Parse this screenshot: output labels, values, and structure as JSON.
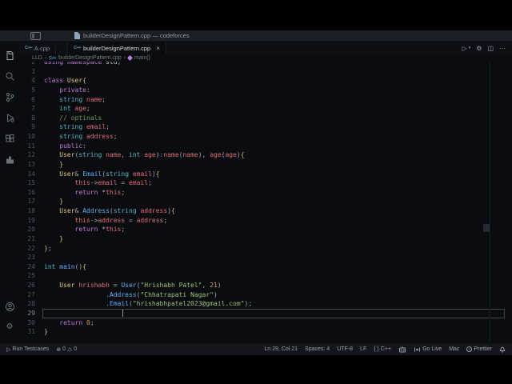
{
  "titlebar": {
    "title": "builderDesignPattern.cpp — codeforces"
  },
  "tabs": {
    "tab1": {
      "label": "A.cpp"
    },
    "tab2": {
      "label": "builderDesignPattern.cpp"
    }
  },
  "icons": {
    "run": "▷",
    "caret": "▾",
    "gear": "⚙",
    "split": "◫",
    "more": "⋯",
    "error": "⊗",
    "warning": "⚠",
    "play": "▷",
    "cpp": "C++",
    "chevron": "›",
    "close": "×",
    "check": "✓"
  },
  "breadcrumb": {
    "folder": "LLD",
    "file": "builderDesignPattern.cpp",
    "symbol": "main()"
  },
  "code": {
    "lines": [
      {
        "n": 2,
        "t": [
          [
            "k",
            "using"
          ],
          [
            "w",
            " "
          ],
          [
            "k",
            "namespace"
          ],
          [
            "w",
            " std"
          ],
          [
            "p",
            ";"
          ]
        ]
      },
      {
        "n": 3,
        "t": []
      },
      {
        "n": 4,
        "t": [
          [
            "k",
            "class"
          ],
          [
            "w",
            " "
          ],
          [
            "c",
            "User"
          ],
          [
            "b",
            "{"
          ]
        ]
      },
      {
        "n": 5,
        "t": [
          [
            "w",
            "    "
          ],
          [
            "k",
            "private"
          ],
          [
            "p",
            ":"
          ]
        ]
      },
      {
        "n": 6,
        "t": [
          [
            "w",
            "    "
          ],
          [
            "t",
            "string"
          ],
          [
            "w",
            " "
          ],
          [
            "v",
            "name"
          ],
          [
            "p",
            ";"
          ]
        ]
      },
      {
        "n": 7,
        "t": [
          [
            "w",
            "    "
          ],
          [
            "t",
            "int"
          ],
          [
            "w",
            " "
          ],
          [
            "v",
            "age"
          ],
          [
            "p",
            ";"
          ]
        ]
      },
      {
        "n": 8,
        "t": [
          [
            "w",
            "    "
          ],
          [
            "m",
            "// optinals"
          ]
        ]
      },
      {
        "n": 9,
        "t": [
          [
            "w",
            "    "
          ],
          [
            "t",
            "string"
          ],
          [
            "w",
            " "
          ],
          [
            "v",
            "email"
          ],
          [
            "p",
            ";"
          ]
        ]
      },
      {
        "n": 10,
        "t": [
          [
            "w",
            "    "
          ],
          [
            "t",
            "string"
          ],
          [
            "w",
            " "
          ],
          [
            "v",
            "address"
          ],
          [
            "p",
            ";"
          ]
        ]
      },
      {
        "n": 11,
        "t": [
          [
            "w",
            "    "
          ],
          [
            "k",
            "public"
          ],
          [
            "p",
            ":"
          ]
        ]
      },
      {
        "n": 12,
        "t": [
          [
            "w",
            "    "
          ],
          [
            "c",
            "User"
          ],
          [
            "p",
            "("
          ],
          [
            "t",
            "string"
          ],
          [
            "w",
            " "
          ],
          [
            "v",
            "name"
          ],
          [
            "p",
            ", "
          ],
          [
            "t",
            "int"
          ],
          [
            "w",
            " "
          ],
          [
            "v",
            "age"
          ],
          [
            "p",
            "):"
          ],
          [
            "v",
            "name"
          ],
          [
            "p",
            "("
          ],
          [
            "v",
            "name"
          ],
          [
            "p",
            "), "
          ],
          [
            "v",
            "age"
          ],
          [
            "p",
            "("
          ],
          [
            "v",
            "age"
          ],
          [
            "p",
            ")"
          ],
          [
            "b",
            "{"
          ]
        ]
      },
      {
        "n": 13,
        "t": [
          [
            "w",
            "    "
          ],
          [
            "b",
            "}"
          ]
        ]
      },
      {
        "n": 14,
        "t": [
          [
            "w",
            "    "
          ],
          [
            "c",
            "User"
          ],
          [
            "p",
            "&"
          ],
          [
            "w",
            " "
          ],
          [
            "f",
            "Email"
          ],
          [
            "p",
            "("
          ],
          [
            "t",
            "string"
          ],
          [
            "w",
            " "
          ],
          [
            "v",
            "email"
          ],
          [
            "p",
            ")"
          ],
          [
            "b",
            "{"
          ]
        ]
      },
      {
        "n": 15,
        "t": [
          [
            "w",
            "        "
          ],
          [
            "v",
            "this"
          ],
          [
            "p",
            "->"
          ],
          [
            "v",
            "email"
          ],
          [
            "p",
            " = "
          ],
          [
            "v",
            "email"
          ],
          [
            "p",
            ";"
          ]
        ]
      },
      {
        "n": 16,
        "t": [
          [
            "w",
            "        "
          ],
          [
            "k",
            "return"
          ],
          [
            "w",
            " "
          ],
          [
            "p",
            "*"
          ],
          [
            "v",
            "this"
          ],
          [
            "p",
            ";"
          ]
        ]
      },
      {
        "n": 17,
        "t": [
          [
            "w",
            "    "
          ],
          [
            "b",
            "}"
          ]
        ]
      },
      {
        "n": 18,
        "t": [
          [
            "w",
            "    "
          ],
          [
            "c",
            "User"
          ],
          [
            "p",
            "&"
          ],
          [
            "w",
            " "
          ],
          [
            "f",
            "Address"
          ],
          [
            "p",
            "("
          ],
          [
            "t",
            "string"
          ],
          [
            "w",
            " "
          ],
          [
            "v",
            "address"
          ],
          [
            "p",
            ")"
          ],
          [
            "b",
            "{"
          ]
        ]
      },
      {
        "n": 19,
        "t": [
          [
            "w",
            "        "
          ],
          [
            "v",
            "this"
          ],
          [
            "p",
            "->"
          ],
          [
            "v",
            "address"
          ],
          [
            "p",
            " = "
          ],
          [
            "v",
            "address"
          ],
          [
            "p",
            ";"
          ]
        ]
      },
      {
        "n": 20,
        "t": [
          [
            "w",
            "        "
          ],
          [
            "k",
            "return"
          ],
          [
            "w",
            " "
          ],
          [
            "p",
            "*"
          ],
          [
            "v",
            "this"
          ],
          [
            "p",
            ";"
          ]
        ]
      },
      {
        "n": 21,
        "t": [
          [
            "w",
            "    "
          ],
          [
            "b",
            "}"
          ]
        ]
      },
      {
        "n": 22,
        "t": [
          [
            "b",
            "}"
          ],
          [
            "p",
            ";"
          ]
        ]
      },
      {
        "n": 23,
        "t": []
      },
      {
        "n": 24,
        "t": [
          [
            "t",
            "int"
          ],
          [
            "w",
            " "
          ],
          [
            "f",
            "main"
          ],
          [
            "p",
            "()"
          ],
          [
            "b",
            "{"
          ]
        ]
      },
      {
        "n": 25,
        "t": []
      },
      {
        "n": 26,
        "t": [
          [
            "w",
            "    "
          ],
          [
            "c",
            "User"
          ],
          [
            "w",
            " "
          ],
          [
            "v",
            "hrishabh"
          ],
          [
            "p",
            " = "
          ],
          [
            "f",
            "User"
          ],
          [
            "p",
            "("
          ],
          [
            "s",
            "\"Hrishabh Patel\""
          ],
          [
            "p",
            ", "
          ],
          [
            "n",
            "21"
          ],
          [
            "p",
            ")"
          ]
        ]
      },
      {
        "n": 27,
        "t": [
          [
            "w",
            "                "
          ],
          [
            "p",
            "."
          ],
          [
            "f",
            "Address"
          ],
          [
            "p",
            "("
          ],
          [
            "s",
            "\"Chhatrapati Nagar\""
          ],
          [
            "p",
            ")"
          ]
        ]
      },
      {
        "n": 28,
        "t": [
          [
            "w",
            "                "
          ],
          [
            "p",
            "."
          ],
          [
            "f",
            "Email"
          ],
          [
            "p",
            "("
          ],
          [
            "s",
            "\"hrishabhpatel2023@gmail.com\""
          ],
          [
            "p",
            ");"
          ]
        ]
      },
      {
        "n": 29,
        "t": [],
        "cur": true
      },
      {
        "n": 30,
        "t": [
          [
            "w",
            "    "
          ],
          [
            "k",
            "return"
          ],
          [
            "w",
            " "
          ],
          [
            "n",
            "0"
          ],
          [
            "p",
            ";"
          ]
        ]
      },
      {
        "n": 31,
        "t": [
          [
            "b",
            "}"
          ]
        ]
      }
    ]
  },
  "status": {
    "run_label": "Run Testcases",
    "errors": "0",
    "warnings": "0",
    "cursor": "Ln 29, Col 21",
    "spaces": "Spaces: 4",
    "encoding": "UTF-8",
    "eol": "LF",
    "braces": "{ }",
    "language": "C++",
    "golive": "Go Live",
    "os": "Mac",
    "prettier": "Prettier"
  }
}
